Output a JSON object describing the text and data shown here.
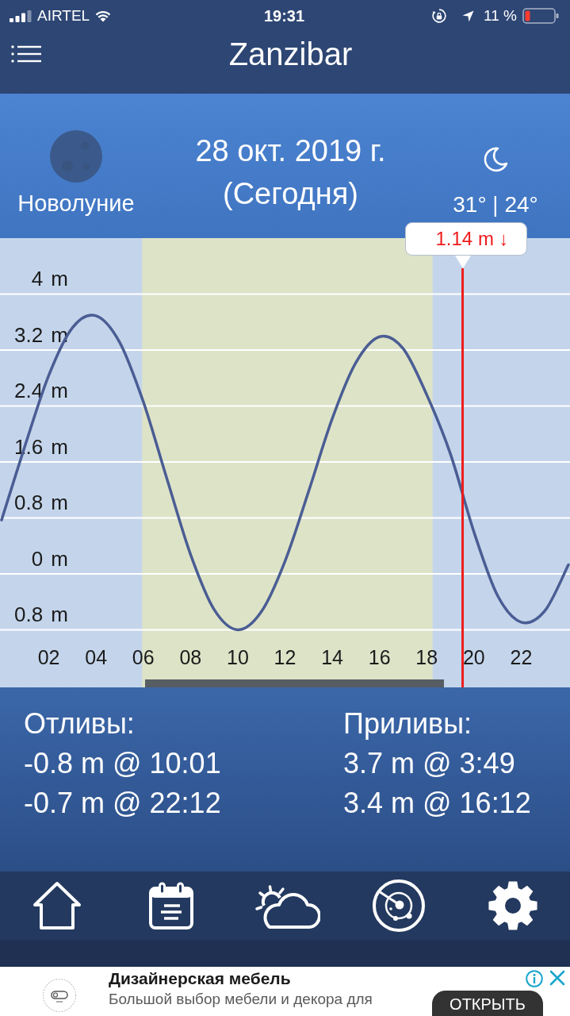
{
  "status_bar": {
    "carrier": "AIRTEL",
    "time": "19:31",
    "battery": "11 %"
  },
  "header": {
    "title": "Zanzibar"
  },
  "day": {
    "moon_phase": "Новолуние",
    "date": "28 окт. 2019 г.",
    "relative_day": "(Сегодня)",
    "temperature": "31° | 24°"
  },
  "chart": {
    "chart_data": {
      "type": "line",
      "x": [
        0,
        1,
        2,
        3,
        4,
        5,
        6,
        7,
        8,
        9,
        10,
        11,
        12,
        13,
        14,
        15,
        16,
        17,
        18,
        19,
        20,
        21,
        22,
        23,
        24
      ],
      "series": [
        {
          "color": "#4a5d94",
          "values": [
            0.77,
            1.84,
            2.84,
            3.52,
            3.69,
            3.31,
            2.46,
            1.36,
            0.28,
            -0.51,
            -0.8,
            -0.54,
            0.18,
            1.18,
            2.22,
            3.02,
            3.39,
            3.22,
            2.56,
            1.72,
            0.6,
            -0.31,
            -0.69,
            -0.53,
            0.13
          ]
        }
      ],
      "xlim": [
        0,
        24
      ],
      "ylim": [
        -1.623,
        4.8
      ],
      "xticks": [
        {
          "value": 2,
          "label": "02"
        },
        {
          "value": 4,
          "label": "04"
        },
        {
          "value": 6,
          "label": "06"
        },
        {
          "value": 8,
          "label": "08"
        },
        {
          "value": 10,
          "label": "10"
        },
        {
          "value": 12,
          "label": "12"
        },
        {
          "value": 14,
          "label": "14"
        },
        {
          "value": 16,
          "label": "16"
        },
        {
          "value": 18,
          "label": "18"
        },
        {
          "value": 20,
          "label": "20"
        },
        {
          "value": 22,
          "label": "22"
        }
      ],
      "yticks": [
        {
          "value": 4,
          "label": "4 m"
        },
        {
          "value": 3.2,
          "label": "3.2 m"
        },
        {
          "value": 2.4,
          "label": "2.4 m"
        },
        {
          "value": 1.6,
          "label": "1.6 m"
        },
        {
          "value": 0.8,
          "label": "0.8 m"
        },
        {
          "value": 0,
          "label": "0 m"
        },
        {
          "value": -0.8,
          "label": "0.8 m"
        }
      ],
      "grid": true,
      "bands": [
        {
          "axis": "x",
          "from": 5.95,
          "to": 18.25,
          "color": "#dde3c7"
        }
      ],
      "ref_lines": [
        {
          "axis": "x",
          "value": 19.52,
          "color": "#ee1c1c",
          "label": "1.14 m ↓"
        }
      ]
    }
  },
  "tides": [
    {
      "title": "Отливы:",
      "entries": [
        "-0.8 m @ 10:01",
        "-0.7 m @ 22:12"
      ]
    },
    {
      "title": "Приливы:",
      "entries": [
        "3.7 m @ 3:49",
        "3.4 m @ 16:12"
      ]
    }
  ],
  "ad": {
    "title": "Дизайнерская мебель",
    "text": "Большой выбор мебели и декора для",
    "button": "ОТКРЫТЬ"
  }
}
